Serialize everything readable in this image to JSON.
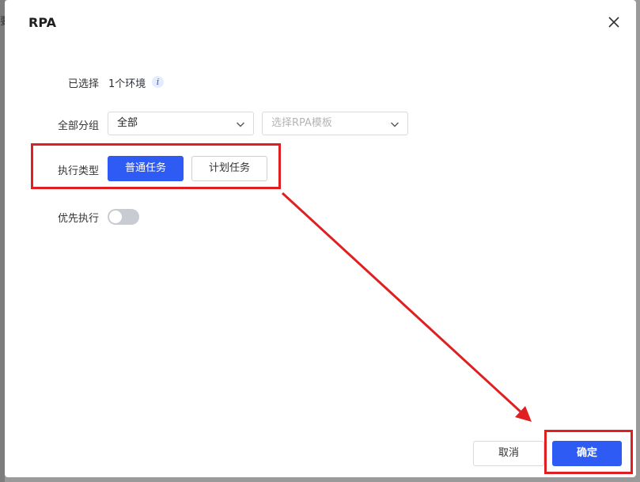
{
  "backdrop": {
    "edge_text": "要"
  },
  "dialog": {
    "title": "RPA",
    "close_icon": "close-icon"
  },
  "form": {
    "selected": {
      "label": "已选择",
      "value": "1个环境",
      "info_icon": "info-icon",
      "info_glyph": "i"
    },
    "group": {
      "label": "全部分组",
      "group_value": "全部",
      "template_placeholder": "选择RPA模板",
      "chevron_icon": "chevron-down-icon"
    },
    "exec_type": {
      "label": "执行类型",
      "options": [
        "普通任务",
        "计划任务"
      ],
      "selected": "普通任务"
    },
    "priority": {
      "label": "优先执行",
      "enabled": false
    }
  },
  "footer": {
    "cancel_label": "取消",
    "ok_label": "确定"
  },
  "annotation": {
    "color": "#e02020",
    "arrow_icon": "arrow-icon"
  },
  "colors": {
    "primary": "#2f5bf5",
    "toggle_off": "#c8cbd2"
  }
}
